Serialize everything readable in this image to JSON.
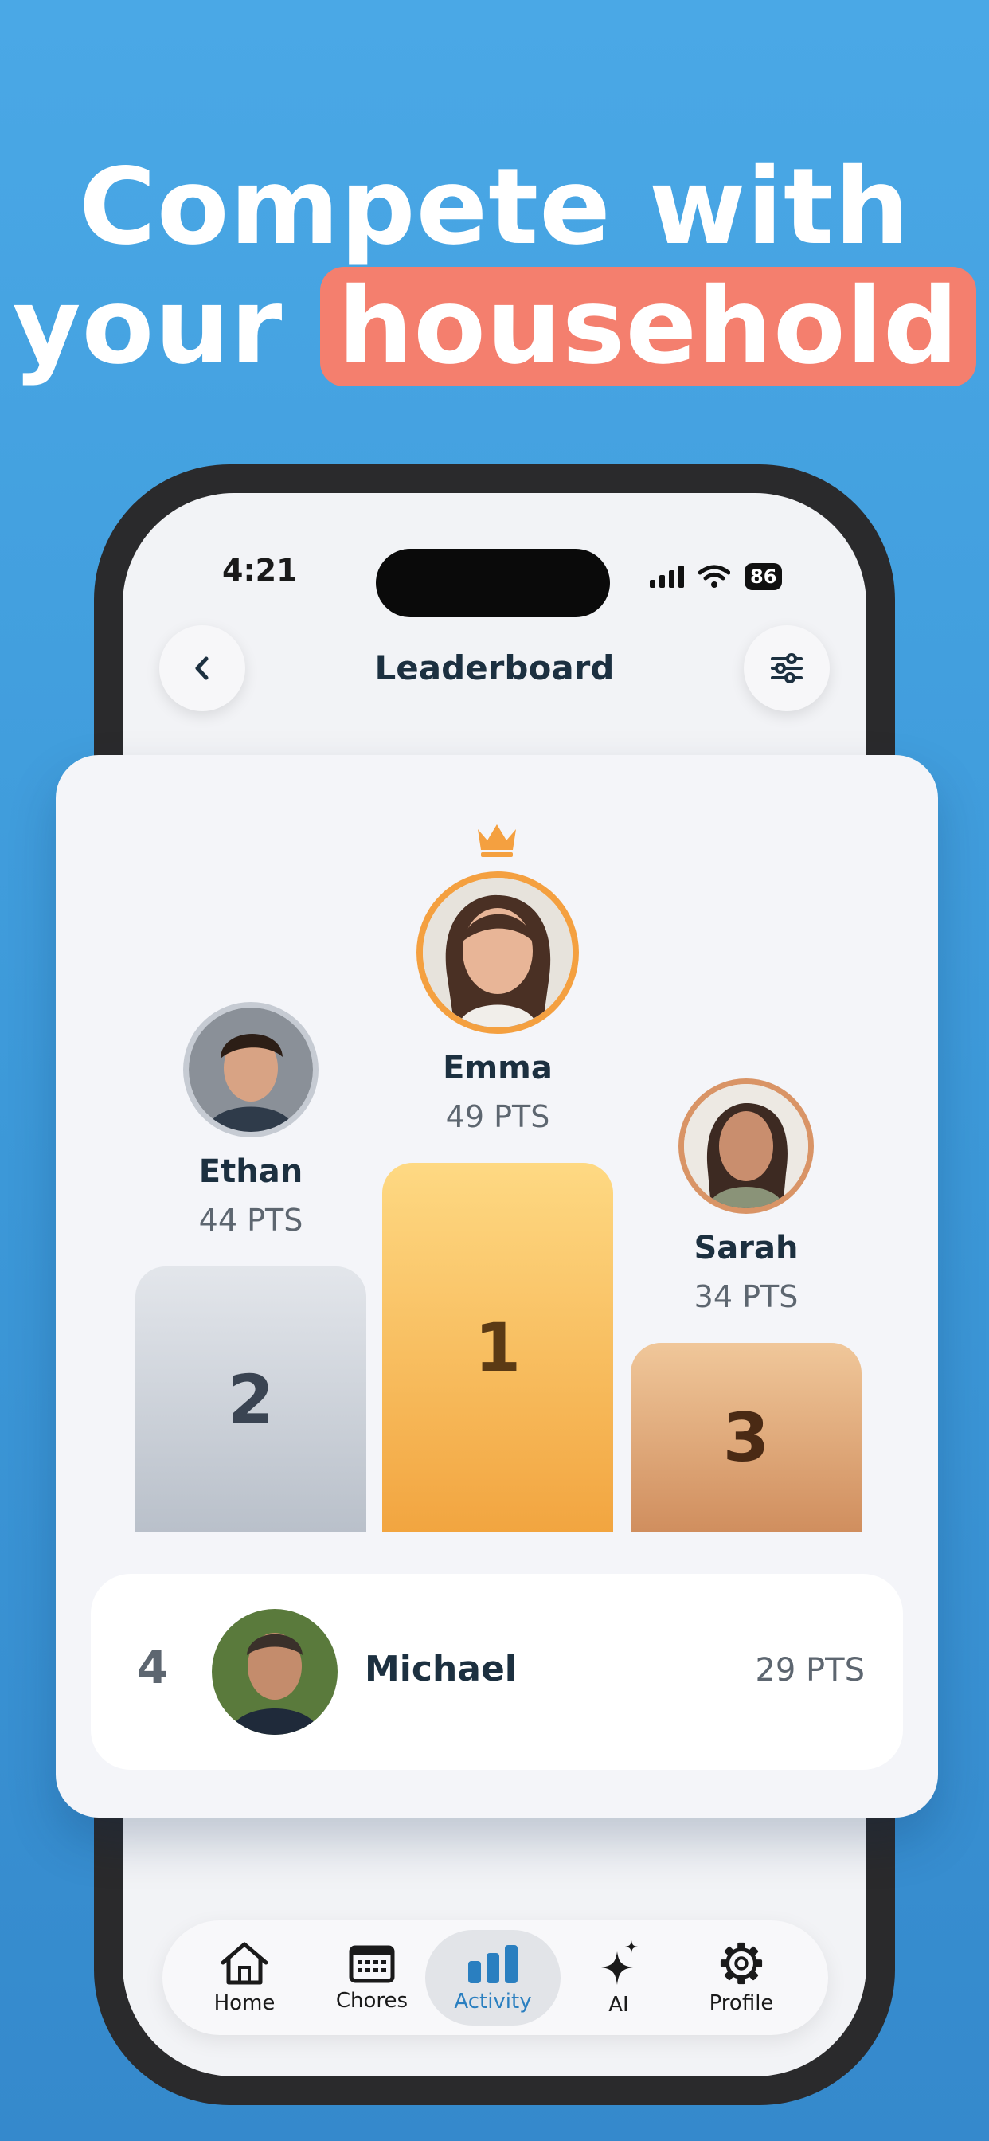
{
  "headline": {
    "line1": "Compete with",
    "line2_prefix": "your",
    "line2_highlight": "household"
  },
  "status_bar": {
    "time": "4:21",
    "battery": "86"
  },
  "header": {
    "title": "Leaderboard"
  },
  "podium": [
    {
      "rank": "2",
      "name": "Ethan",
      "points": "44 PTS",
      "ring_color": "#C6CBD3"
    },
    {
      "rank": "1",
      "name": "Emma",
      "points": "49 PTS",
      "ring_color": "#F4A040"
    },
    {
      "rank": "3",
      "name": "Sarah",
      "points": "34 PTS",
      "ring_color": "#D99466"
    }
  ],
  "list": [
    {
      "rank": "4",
      "name": "Michael",
      "points": "29 PTS"
    }
  ],
  "tabs": [
    {
      "label": "Home",
      "icon": "house-icon"
    },
    {
      "label": "Chores",
      "icon": "calendar-icon"
    },
    {
      "label": "Activity",
      "icon": "bar-chart-icon",
      "active": true
    },
    {
      "label": "AI",
      "icon": "sparkle-icon"
    },
    {
      "label": "Profile",
      "icon": "gear-icon"
    }
  ],
  "colors": {
    "background": "#4AA8E6",
    "highlight": "#F47F6E",
    "gold": "#F4A040",
    "active_tab": "#2A7FC0"
  }
}
